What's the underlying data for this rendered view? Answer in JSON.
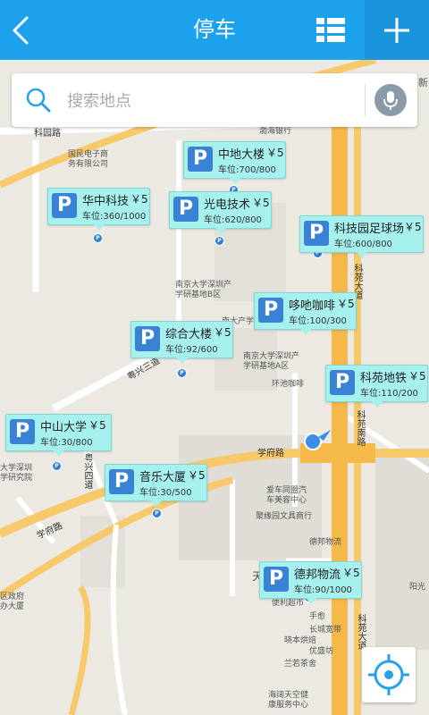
{
  "header": {
    "title": "停车",
    "back_icon": "chevron-left-icon",
    "list_icon": "list-icon",
    "add_icon": "plus-icon"
  },
  "search": {
    "placeholder": "搜索地点",
    "search_icon": "search-icon",
    "mic_icon": "microphone-icon"
  },
  "colors": {
    "header_bg": "#1ca1ec",
    "card_bg": "#a6f0ee",
    "badge_bg": "#3a82d6",
    "major_road": "#f7c96a"
  },
  "parking_lots": [
    {
      "name": "中地大楼",
      "price": "￥5",
      "spaces_label": "车位",
      "spaces": "700/800"
    },
    {
      "name": "华中科技",
      "price": "￥5",
      "spaces_label": "车位",
      "spaces": "360/1000"
    },
    {
      "name": "光电技术",
      "price": "￥5",
      "spaces_label": "车位",
      "spaces": "620/800"
    },
    {
      "name": "科技园足球场",
      "price": "￥5",
      "spaces_label": "车位",
      "spaces": "600/800"
    },
    {
      "name": "哆吔咖啡",
      "price": "￥5",
      "spaces_label": "车位",
      "spaces": "100/300"
    },
    {
      "name": "综合大楼",
      "price": "￥5",
      "spaces_label": "车位",
      "spaces": "92/600"
    },
    {
      "name": "科苑地铁",
      "price": "￥5",
      "spaces_label": "车位",
      "spaces": "110/200"
    },
    {
      "name": "中山大学",
      "price": "￥5",
      "spaces_label": "车位",
      "spaces": "30/800"
    },
    {
      "name": "音乐大厦",
      "price": "￥5",
      "spaces_label": "车位",
      "spaces": "30/500"
    },
    {
      "name": "德邦物流",
      "price": "￥5",
      "spaces_label": "车位",
      "spaces": "90/1000"
    }
  ],
  "map_labels": {
    "road_1": "科园路",
    "road_2": "科苑大道",
    "road_3": "学府路",
    "road_4": "学府路",
    "road_5": "科苑南路",
    "road_6": "粤兴三道",
    "road_7": "粤兴四道",
    "road_8": "科苑大道",
    "place_1": "国民电子商\n务有限公司",
    "place_2": "渤海银行",
    "place_3": "南京大学深圳产\n学研基地B区",
    "place_4": "南京大学深圳产\n学研基地A区",
    "place_5": "南大产学",
    "place_6": "环池咖啡",
    "place_7": "爱车同盟汽\n车美容中心",
    "place_8": "聚缘园文具商行",
    "place_9": "德邦物流",
    "place_10": "便利超市",
    "place_11": "手愈",
    "place_12": "长城宽带",
    "place_13": "晓本烘焙",
    "place_14": "优盛坊",
    "place_15": "兰若茶舍",
    "place_16": "海阔天空健\n康服务中心",
    "place_17": "阳光",
    "place_18": "大学深圳\n学研究院",
    "place_19": "区政府\n办大厦",
    "place_20": "天",
    "place_21": "新"
  },
  "locate": {
    "icon": "crosshair-icon"
  }
}
